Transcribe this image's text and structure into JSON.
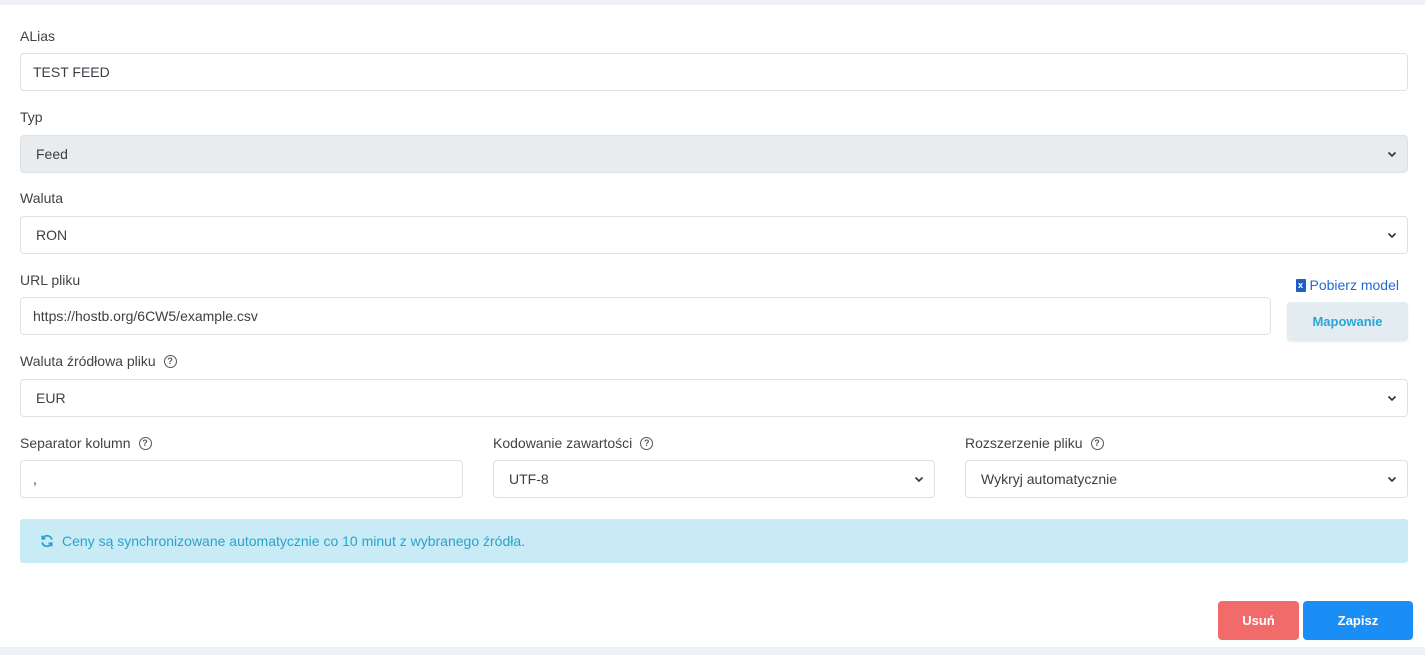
{
  "form": {
    "alias": {
      "label": "ALias",
      "value": "TEST FEED"
    },
    "typ": {
      "label": "Typ",
      "value": "Feed"
    },
    "waluta": {
      "label": "Waluta",
      "value": "RON"
    },
    "url": {
      "label": "URL pliku",
      "value": "https://hostb.org/6CW5/example.csv",
      "download_link": "Pobierz model",
      "mapping_button": "Mapowanie"
    },
    "source_currency": {
      "label": "Waluta źródłowa pliku",
      "value": "EUR"
    },
    "separator": {
      "label": "Separator kolumn",
      "value": ","
    },
    "encoding": {
      "label": "Kodowanie zawartości",
      "value": "UTF-8"
    },
    "extension": {
      "label": "Rozszerzenie pliku",
      "value": "Wykryj automatycznie"
    }
  },
  "alert": {
    "text": "Ceny są synchronizowane automatycznie co 10 minut z wybranego źródła."
  },
  "actions": {
    "delete_label": "Usuń",
    "save_label": "Zapisz"
  },
  "colors": {
    "accent": "#1a8ef5",
    "danger": "#f26b6b",
    "info_bg": "#c8ebf6",
    "info_text": "#29a3cc",
    "link": "#1f6bd2"
  },
  "icons": {
    "help": "question-circle-icon",
    "select_arrow": "chevron-down-icon",
    "download": "excel-file-icon",
    "alert": "sync-icon"
  },
  "help_glyph": "?",
  "xls_glyph": "x"
}
